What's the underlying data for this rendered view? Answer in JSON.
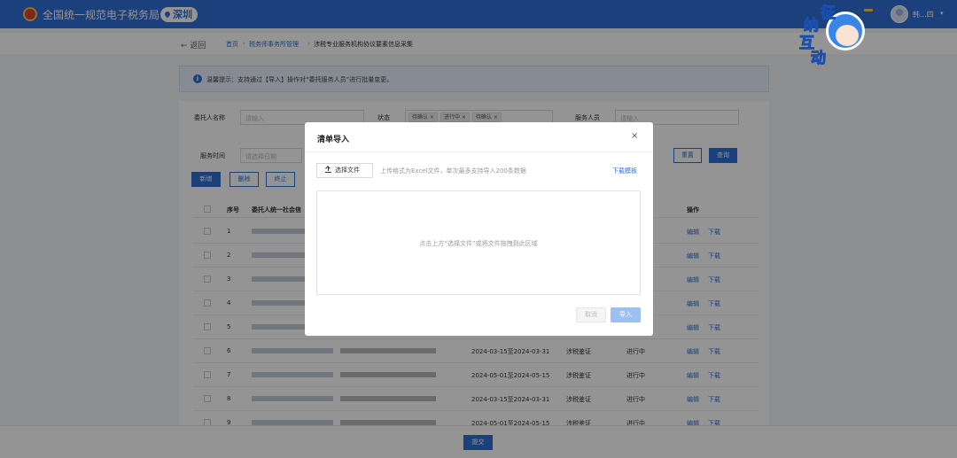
{
  "header": {
    "app_title": "全国统一规范电子税务局",
    "city": "深圳",
    "user_name": "韩...四",
    "mascot_chars": [
      "征",
      "纳",
      "互",
      "动"
    ]
  },
  "breadcrumb": {
    "back": "← 返回",
    "items": [
      "首页",
      "税务师事务所管理",
      "涉税专业服务机构协议要素信息采集"
    ]
  },
  "tip": {
    "text": "温馨提示：支持通过【导入】操作对“委托服务人员”进行批量变更。"
  },
  "filters": {
    "client_label": "委托人名称",
    "client_placeholder": "请输入",
    "status_label": "状态",
    "status_tags": [
      "待确认",
      "进行中",
      "待确认"
    ],
    "staff_label": "服务人员",
    "staff_placeholder": "请输入",
    "time_label": "服务时间",
    "time_placeholder": "请选择日期",
    "reset": "重置",
    "query": "查询"
  },
  "toolbar": {
    "add": "新增",
    "delete": "删除",
    "stop": "终止"
  },
  "table": {
    "columns": [
      "序号",
      "委托人统一社会信",
      "操作"
    ],
    "rows": [
      {
        "no": "1",
        "period": "",
        "type": "",
        "status": ""
      },
      {
        "no": "2",
        "period": "",
        "type": "",
        "status": ""
      },
      {
        "no": "3",
        "period": "",
        "type": "",
        "status": ""
      },
      {
        "no": "4",
        "period": "",
        "type": "",
        "status": ""
      },
      {
        "no": "5",
        "period": "",
        "type": "",
        "status": ""
      },
      {
        "no": "6",
        "period": "2024-03-15至2024-03-31",
        "type": "涉税鉴证",
        "status": "进行中"
      },
      {
        "no": "7",
        "period": "2024-05-01至2024-05-15",
        "type": "涉税鉴证",
        "status": "进行中"
      },
      {
        "no": "8",
        "period": "2024-03-15至2024-03-31",
        "type": "涉税鉴证",
        "status": "进行中"
      },
      {
        "no": "9",
        "period": "2024-05-01至2024-05-15",
        "type": "涉税鉴证",
        "status": "进行中"
      }
    ],
    "edit": "编辑",
    "download": "下载"
  },
  "footer": {
    "submit": "提交"
  },
  "modal": {
    "title": "清单导入",
    "close": "×",
    "upload_button": "选择文件",
    "upload_hint": "上传格式为Excel文件，单次最多支持导入200条数据",
    "download_template": "下载模板",
    "drop_text": "点击上方“选择文件”或将文件拖拽到此区域",
    "cancel": "取消",
    "import": "导入"
  },
  "colors": {
    "primary": "#2f6fd6",
    "overlay": "rgba(0,0,0,0.42)"
  }
}
